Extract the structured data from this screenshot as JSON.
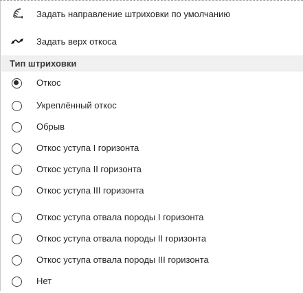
{
  "commands": [
    {
      "label": "Задать направление штриховки по умолчанию",
      "icon": "hatch-direction-icon"
    },
    {
      "label": "Задать верх откоса",
      "icon": "slope-top-arrows-icon"
    }
  ],
  "hatch_type": {
    "title": "Тип штриховки",
    "selected": "Откос",
    "options": [
      {
        "label": "Откос",
        "checked": true
      },
      {
        "label": "Укреплённый откос",
        "checked": false
      },
      {
        "label": "Обрыв",
        "checked": false
      },
      {
        "label": "Откос уступа I горизонта",
        "checked": false
      },
      {
        "label": "Откос уступа II горизонта",
        "checked": false
      },
      {
        "label": "Откос уступа III горизонта",
        "checked": false
      },
      {
        "label": "Откос уступа отвала породы I горизонта",
        "checked": false
      },
      {
        "label": "Откос уступа отвала породы II горизонта",
        "checked": false
      },
      {
        "label": "Откос уступа отвала породы III горизонта",
        "checked": false
      },
      {
        "label": "Нет",
        "checked": false
      }
    ]
  }
}
